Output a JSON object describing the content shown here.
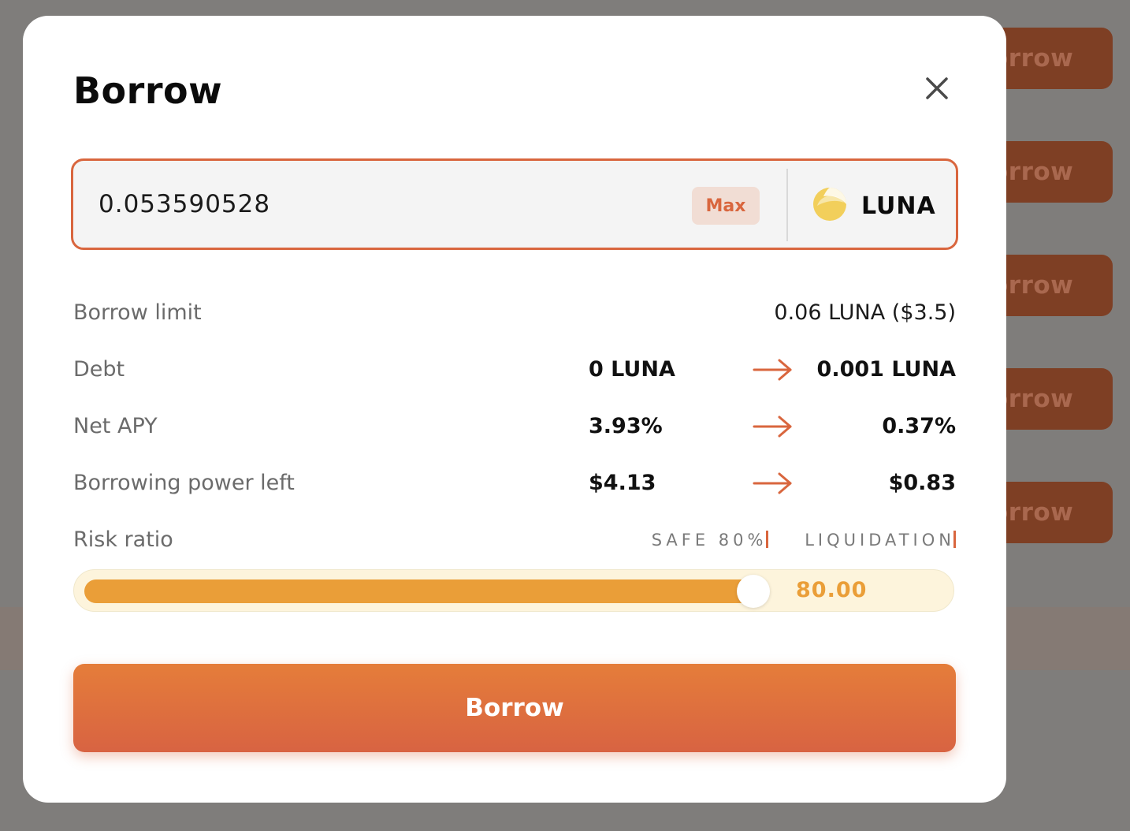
{
  "background": {
    "button_label": "orrow"
  },
  "modal": {
    "title": "Borrow",
    "amount_value": "0.053590528",
    "max_label": "Max",
    "token": {
      "symbol": "LUNA",
      "icon": "luna-icon"
    },
    "borrow_limit": {
      "label": "Borrow limit",
      "value": "0.06 LUNA ($3.5)"
    },
    "debt": {
      "label": "Debt",
      "from": "0 LUNA",
      "to": "0.001 LUNA"
    },
    "net_apy": {
      "label": "Net APY",
      "from": "3.93%",
      "to": "0.37%"
    },
    "borrowing_power": {
      "label": "Borrowing power left",
      "from": "$4.13",
      "to": "$0.83"
    },
    "risk_ratio": {
      "label": "Risk ratio",
      "safe_label": "SAFE 80%",
      "liquidation_label": "LIQUIDATION",
      "value": "80.00",
      "level_fraction": 0.8
    },
    "submit_label": "Borrow"
  },
  "colors": {
    "accent": "#d9663e",
    "slider_fill": "#ea9e38",
    "luna_yellow": "#f2cf5b"
  }
}
